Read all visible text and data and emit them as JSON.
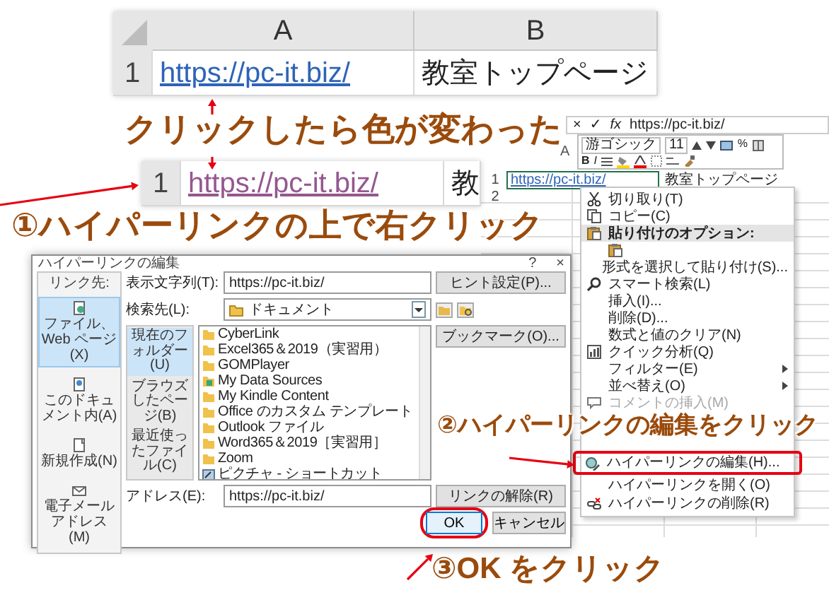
{
  "top_sheet": {
    "columns": [
      "A",
      "B"
    ],
    "rows": [
      {
        "row_number": "1",
        "cells": [
          {
            "kind": "link",
            "text": "https://pc-it.biz/",
            "visited": false
          },
          {
            "kind": "text",
            "text": "教室トップページ"
          }
        ]
      }
    ]
  },
  "annotations": [
    {
      "text": "クリックしたら色が変わった"
    },
    {
      "text": "①ハイパーリンクの上で右クリック"
    },
    {
      "text": "②ハイパーリンクの編集をクリック"
    },
    {
      "text": "③OK をクリック"
    }
  ],
  "second_sheet": {
    "rows": [
      {
        "row_number": "1",
        "cells": [
          {
            "kind": "link",
            "text": "https://pc-it.biz/",
            "visited": true
          },
          {
            "kind": "text",
            "text": "教"
          }
        ]
      }
    ]
  },
  "right_sheet": {
    "formula_bar": {
      "cancel": "×",
      "enter": "✓",
      "function": "fx",
      "value": "https://pc-it.biz/"
    },
    "column_header": "A",
    "mini_toolbar": {
      "font": "游ゴシック",
      "size": "11",
      "percent": "%",
      "bold": "B",
      "italic": "I"
    },
    "rows": [
      {
        "row_number": "1",
        "cells": [
          {
            "kind": "link",
            "text": "https://pc-it.biz/",
            "visited": false
          },
          {
            "kind": "text",
            "text": "教室トップページ"
          }
        ]
      },
      {
        "row_number": "2"
      }
    ]
  },
  "context_menu": {
    "items": [
      {
        "kind": "item",
        "label": "切り取り(T)",
        "disabled": false,
        "has_submenu": false
      },
      {
        "kind": "item",
        "label": "コピー(C)",
        "disabled": false,
        "has_submenu": false
      },
      {
        "kind": "header",
        "label": "貼り付けのオプション:"
      },
      {
        "kind": "paste-options"
      },
      {
        "kind": "item",
        "label": "形式を選択して貼り付け(S)...",
        "disabled": false,
        "has_submenu": false
      },
      {
        "kind": "item",
        "label": "スマート検索(L)",
        "disabled": false,
        "has_submenu": false
      },
      {
        "kind": "item",
        "label": "挿入(I)...",
        "disabled": false,
        "has_submenu": false
      },
      {
        "kind": "item",
        "label": "削除(D)...",
        "disabled": false,
        "has_submenu": false
      },
      {
        "kind": "item",
        "label": "数式と値のクリア(N)",
        "disabled": false,
        "has_submenu": false
      },
      {
        "kind": "item",
        "label": "クイック分析(Q)",
        "disabled": false,
        "has_submenu": false
      },
      {
        "kind": "item",
        "label": "フィルター(E)",
        "disabled": false,
        "has_submenu": true
      },
      {
        "kind": "item",
        "label": "並べ替え(O)",
        "disabled": false,
        "has_submenu": true
      },
      {
        "kind": "item",
        "label": "コメントの挿入(M)",
        "disabled": true,
        "has_submenu": false
      }
    ],
    "lower_items": [
      {
        "kind": "item",
        "label": "ハイパーリンクの編集(H)...",
        "disabled": false,
        "has_submenu": false,
        "highlighted": true
      },
      {
        "kind": "item",
        "label": "ハイパーリンクを開く(O)",
        "disabled": false,
        "has_submenu": false,
        "highlighted": false
      },
      {
        "kind": "item",
        "label": "ハイパーリンクの削除(R)",
        "disabled": false,
        "has_submenu": false,
        "highlighted": false
      }
    ]
  },
  "dialog": {
    "title": "ハイパーリンクの編集",
    "help": "?",
    "close": "×",
    "link_to_label": "リンク先:",
    "link_to": [
      {
        "label": "ファイル、Web ページ(X)",
        "selected": true
      },
      {
        "label": "このドキュメント内(A)",
        "selected": false
      },
      {
        "label": "新規作成(N)",
        "selected": false
      },
      {
        "label": "電子メールアドレス(M)",
        "selected": false
      }
    ],
    "display_text_label": "表示文字列(T):",
    "display_text": "https://pc-it.biz/",
    "screen_tip_button": "ヒント設定(P)...",
    "look_in_label": "検索先(L):",
    "look_in": "ドキュメント",
    "browse_tabs": [
      {
        "label": "現在のフォルダー(U)",
        "selected": true
      },
      {
        "label": "ブラウズしたページ(B)",
        "selected": false
      },
      {
        "label": "最近使ったファイル(C)",
        "selected": false
      }
    ],
    "files": [
      {
        "kind": "folder",
        "name": "CyberLink"
      },
      {
        "kind": "folder",
        "name": "Excel365＆2019（実習用）"
      },
      {
        "kind": "folder",
        "name": "GOMPlayer"
      },
      {
        "kind": "data",
        "name": "My Data Sources"
      },
      {
        "kind": "folder",
        "name": "My Kindle Content"
      },
      {
        "kind": "folder",
        "name": "Office のカスタム テンプレート"
      },
      {
        "kind": "folder",
        "name": "Outlook ファイル"
      },
      {
        "kind": "folder",
        "name": "Word365＆2019［実習用］"
      },
      {
        "kind": "folder",
        "name": "Zoom"
      },
      {
        "kind": "shortcut",
        "name": "ピクチャ - ショートカット"
      }
    ],
    "bookmark_button": "ブックマーク(O)...",
    "address_label": "アドレス(E):",
    "address": "https://pc-it.biz/",
    "remove_link_button": "リンクの解除(R)",
    "ok_button": {
      "label": "OK",
      "circled": true
    },
    "cancel_button": "キャンセル"
  }
}
